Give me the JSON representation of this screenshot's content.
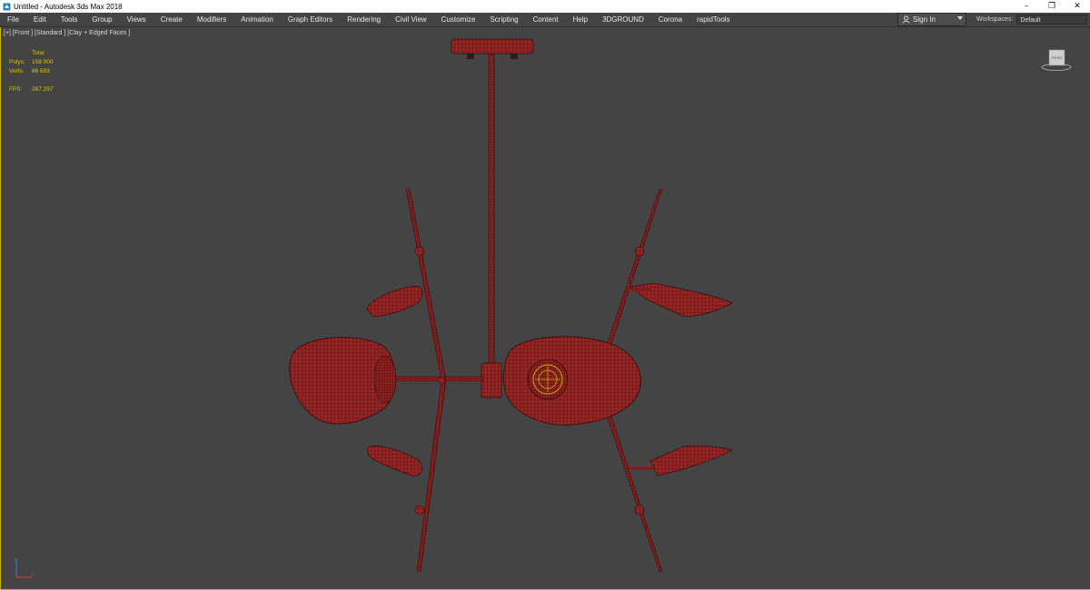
{
  "titlebar": {
    "title": "Untitled - Autodesk 3ds Max 2018",
    "minimize": "–",
    "restore": "❐",
    "close": "✕"
  },
  "menubar": {
    "items": [
      {
        "label": "File"
      },
      {
        "label": "Edit"
      },
      {
        "label": "Tools"
      },
      {
        "label": "Group"
      },
      {
        "label": "Views"
      },
      {
        "label": "Create"
      },
      {
        "label": "Modifiers"
      },
      {
        "label": "Animation"
      },
      {
        "label": "Graph Editors"
      },
      {
        "label": "Rendering"
      },
      {
        "label": "Civil View"
      },
      {
        "label": "Customize"
      },
      {
        "label": "Scripting"
      },
      {
        "label": "Content"
      },
      {
        "label": "Help"
      },
      {
        "label": "3DGROUND"
      },
      {
        "label": "Corona"
      },
      {
        "label": "rapidTools"
      }
    ],
    "signin_label": "Sign In",
    "workspaces_label": "Workspaces:",
    "workspaces_value": "Default"
  },
  "viewport": {
    "label": "[+] [Front ] [Standard ] [Clay + Edged Faces ]",
    "stats": {
      "header": "Total",
      "polys_label": "Polys:",
      "polys_value": "158 000",
      "verts_label": "Verts:",
      "verts_value": "86 693",
      "fps_label": "FPS:",
      "fps_value": "387,297"
    },
    "viewcube_label": "FRONT"
  },
  "icons": {
    "app": "3dsmax-app-icon",
    "user": "user-icon",
    "dropdown": "chevron-down-icon",
    "viewcube": "viewcube-icon",
    "axis": "axis-tripod-icon"
  },
  "colors": {
    "viewport_bg": "#444444",
    "active_border": "#c9b300",
    "stats_text": "#d8c600",
    "model_wire": "#a52a2a",
    "model_fill": "#8c1f1f"
  }
}
